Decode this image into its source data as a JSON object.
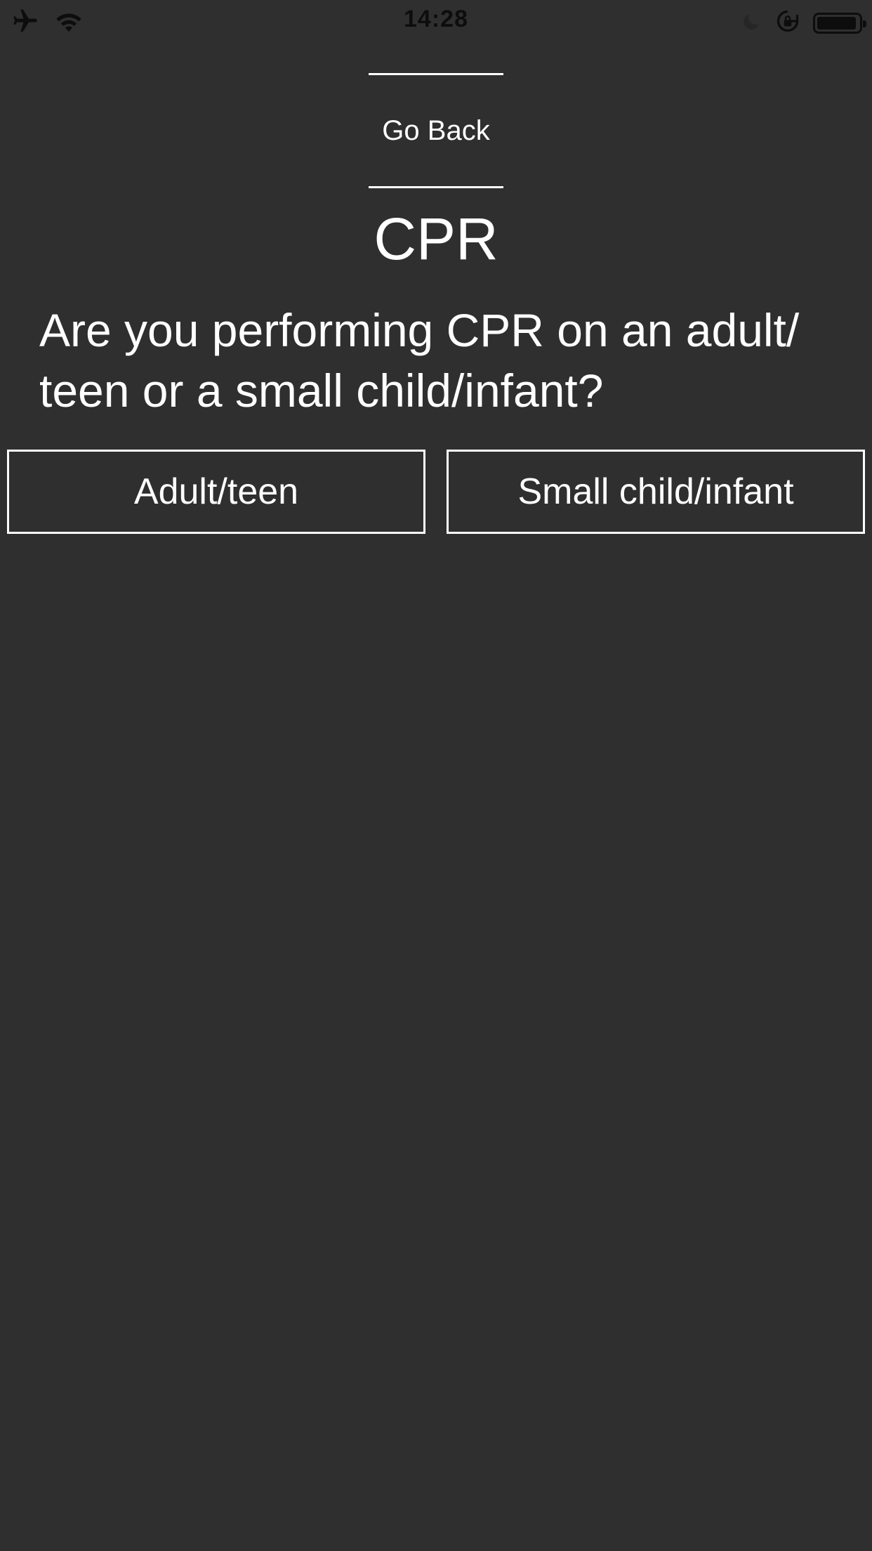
{
  "status_bar": {
    "time": "14:28",
    "icons": [
      "airplane-icon",
      "wifi-icon",
      "moon-icon",
      "rotation-lock-icon",
      "battery-icon"
    ],
    "battery_level": 0.95
  },
  "nav": {
    "go_back_label": "Go Back"
  },
  "page": {
    "title": "CPR",
    "question": "Are you performing CPR on an adult/ teen or a small child/infant?"
  },
  "options": [
    {
      "label": "Adult/teen"
    },
    {
      "label": "Small child/infant"
    }
  ],
  "colors": {
    "background": "#2f2f2f",
    "text": "#ffffff",
    "status_text": "#0d0d0d"
  }
}
